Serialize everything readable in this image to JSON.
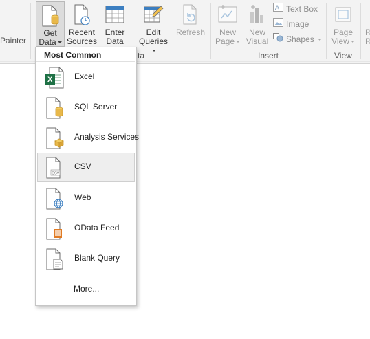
{
  "ribbon": {
    "painter_label": "Painter",
    "get_data": {
      "line1": "Get",
      "line2": "Data"
    },
    "recent_sources": {
      "line1": "Recent",
      "line2": "Sources"
    },
    "enter_data": {
      "line1": "Enter",
      "line2": "Data"
    },
    "edit_queries": {
      "line1": "Edit",
      "line2": "Queries"
    },
    "refresh": {
      "label": "Refresh"
    },
    "new_page": {
      "line1": "New",
      "line2": "Page"
    },
    "new_visual": {
      "line1": "New",
      "line2": "Visual"
    },
    "text_box": "Text Box",
    "image": "Image",
    "shapes": "Shapes",
    "page_view": {
      "line1": "Page",
      "line2": "View"
    },
    "truncated_right": {
      "line1": "R",
      "line2": "R"
    },
    "groups": {
      "data_partial": "ta",
      "insert": "Insert",
      "view": "View"
    }
  },
  "menu": {
    "header": "Most Common",
    "items": [
      {
        "label": "Excel",
        "icon": "excel-icon"
      },
      {
        "label": "SQL Server",
        "icon": "sql-server-icon"
      },
      {
        "label": "Analysis Services",
        "icon": "analysis-services-icon"
      },
      {
        "label": "CSV",
        "icon": "csv-icon"
      },
      {
        "label": "Web",
        "icon": "web-icon"
      },
      {
        "label": "OData Feed",
        "icon": "odata-feed-icon"
      },
      {
        "label": "Blank Query",
        "icon": "blank-query-icon"
      }
    ],
    "more": "More..."
  },
  "colors": {
    "excel_green": "#1e7145",
    "db_yellow": "#e8b84a",
    "globe_blue": "#3c7fc1",
    "odata_orange": "#e07b24"
  }
}
